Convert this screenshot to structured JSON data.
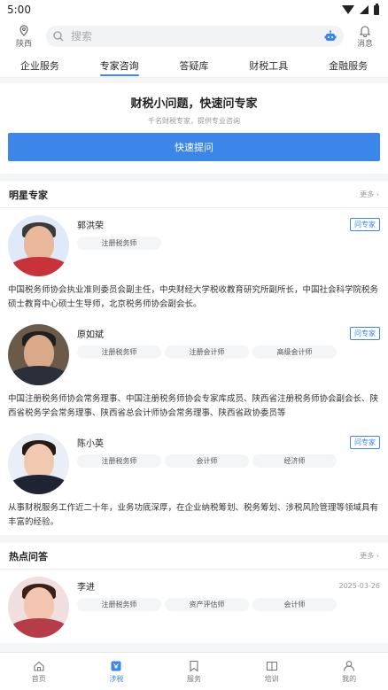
{
  "status_bar": {
    "time": "5:00"
  },
  "header": {
    "location": "陕西",
    "search_placeholder": "搜索",
    "messages": "消息"
  },
  "tabs": [
    {
      "label": "企业服务"
    },
    {
      "label": "专家咨询",
      "active": true
    },
    {
      "label": "答疑库"
    },
    {
      "label": "财税工具"
    },
    {
      "label": "金融服务"
    }
  ],
  "ask": {
    "title": "财税小问题，快速问专家",
    "subtitle": "千名财税专家，提供专业咨询",
    "button": "快速提问"
  },
  "star_experts": {
    "title": "明星专家",
    "more": "更多",
    "ask_label": "问专家",
    "experts": [
      {
        "name": "郭洪荣",
        "tags": [
          "注册税务师"
        ],
        "desc": "中国税务师协会执业准则委员会副主任，中央财经大学税收教育研究所副所长，中国社会科学院税务硕士教育中心硕士生导师，北京税务师协会副会长。"
      },
      {
        "name": "原如斌",
        "tags": [
          "注册税务师",
          "注册会计师",
          "高级会计师"
        ],
        "desc": "中国注册税务师协会常务理事、中国注册税务师协会专家库成员、陕西省注册税务师协会副会长、陕西省税务学会常务理事、陕西省总会计师协会常务理事、陕西省政协委员等"
      },
      {
        "name": "陈小英",
        "tags": [
          "注册税务师",
          "会计师",
          "经济师"
        ],
        "desc": "从事财税服务工作近二十年，业务功底深厚，在企业纳税筹划、税务筹划、涉税风险管理等领域具有丰富的经验。"
      }
    ]
  },
  "hot_qa": {
    "title": "热点问答",
    "more": "更多",
    "items": [
      {
        "name": "李进",
        "date": "2025-03-26",
        "tags": [
          "注册税务师",
          "资产评估师",
          "会计师"
        ]
      }
    ]
  },
  "bottom_nav": [
    {
      "label": "首页",
      "icon": "home-icon"
    },
    {
      "label": "涉税",
      "icon": "tax-icon",
      "active": true
    },
    {
      "label": "服务",
      "icon": "bookmark-icon"
    },
    {
      "label": "培训",
      "icon": "book-icon"
    },
    {
      "label": "我的",
      "icon": "user-icon"
    }
  ],
  "colors": {
    "accent": "#3b86e8"
  }
}
